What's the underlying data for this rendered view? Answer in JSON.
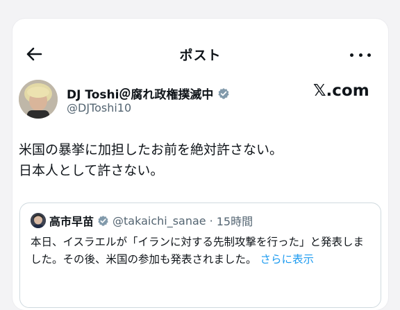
{
  "header": {
    "title": "ポスト"
  },
  "author": {
    "display_name": "DJ Toshi＠腐れ政権撲滅中",
    "handle": "@DJToshi10"
  },
  "watermark": "𝕏.com",
  "post": {
    "lines": [
      "米国の暴挙に加担したお前を絶対許さない。",
      "日本人として許さない。"
    ]
  },
  "quoted": {
    "name": "高市早苗",
    "handle": "@takaichi_sanae",
    "separator": "·",
    "time": "15時間",
    "text": "本日、イスラエルが「イランに対する先制攻撃を行った」と発表しました。その後、米国の参加も発表されました。",
    "show_more": "さらに表示"
  },
  "colors": {
    "link": "#1d9bf0",
    "verified": "#829aab",
    "muted": "#536471"
  }
}
